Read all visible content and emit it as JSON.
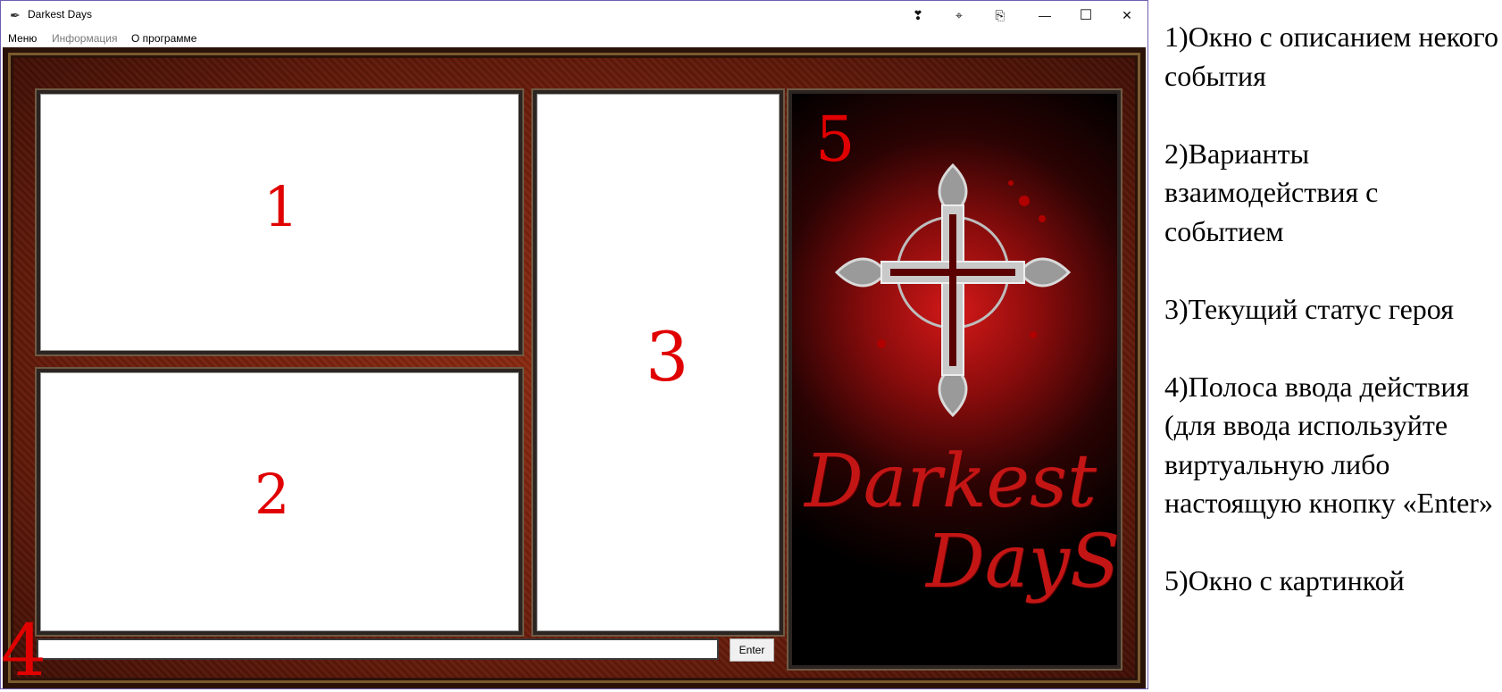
{
  "window": {
    "title": "Darkest Days",
    "title_buttons": [
      "❣",
      "⌖",
      "⎘"
    ],
    "controls": {
      "minimize": "—",
      "maximize": "☐",
      "close": "✕"
    }
  },
  "menu": {
    "items": [
      {
        "label": "Меню",
        "enabled": true
      },
      {
        "label": "Информация",
        "enabled": false
      },
      {
        "label": "О программе",
        "enabled": true
      }
    ]
  },
  "panels": {
    "p1": "1",
    "p2": "2",
    "p3": "3",
    "p4": "4",
    "p5": "5"
  },
  "input": {
    "value": "",
    "enter_label": "Enter"
  },
  "logo": {
    "line1": "Darkest",
    "line2": "DayS"
  },
  "legend": [
    "1)Окно с описанием некого события",
    "2)Варианты взаимодействия с событием",
    "3)Текущий статус героя",
    "4)Полоса ввода действия (для ввода используйте виртуальную либо настоящую кнопку «Enter»",
    "5)Окно с картинкой"
  ],
  "colors": {
    "accent_red": "#e00000",
    "frame_brown": "#6b1d0b"
  }
}
